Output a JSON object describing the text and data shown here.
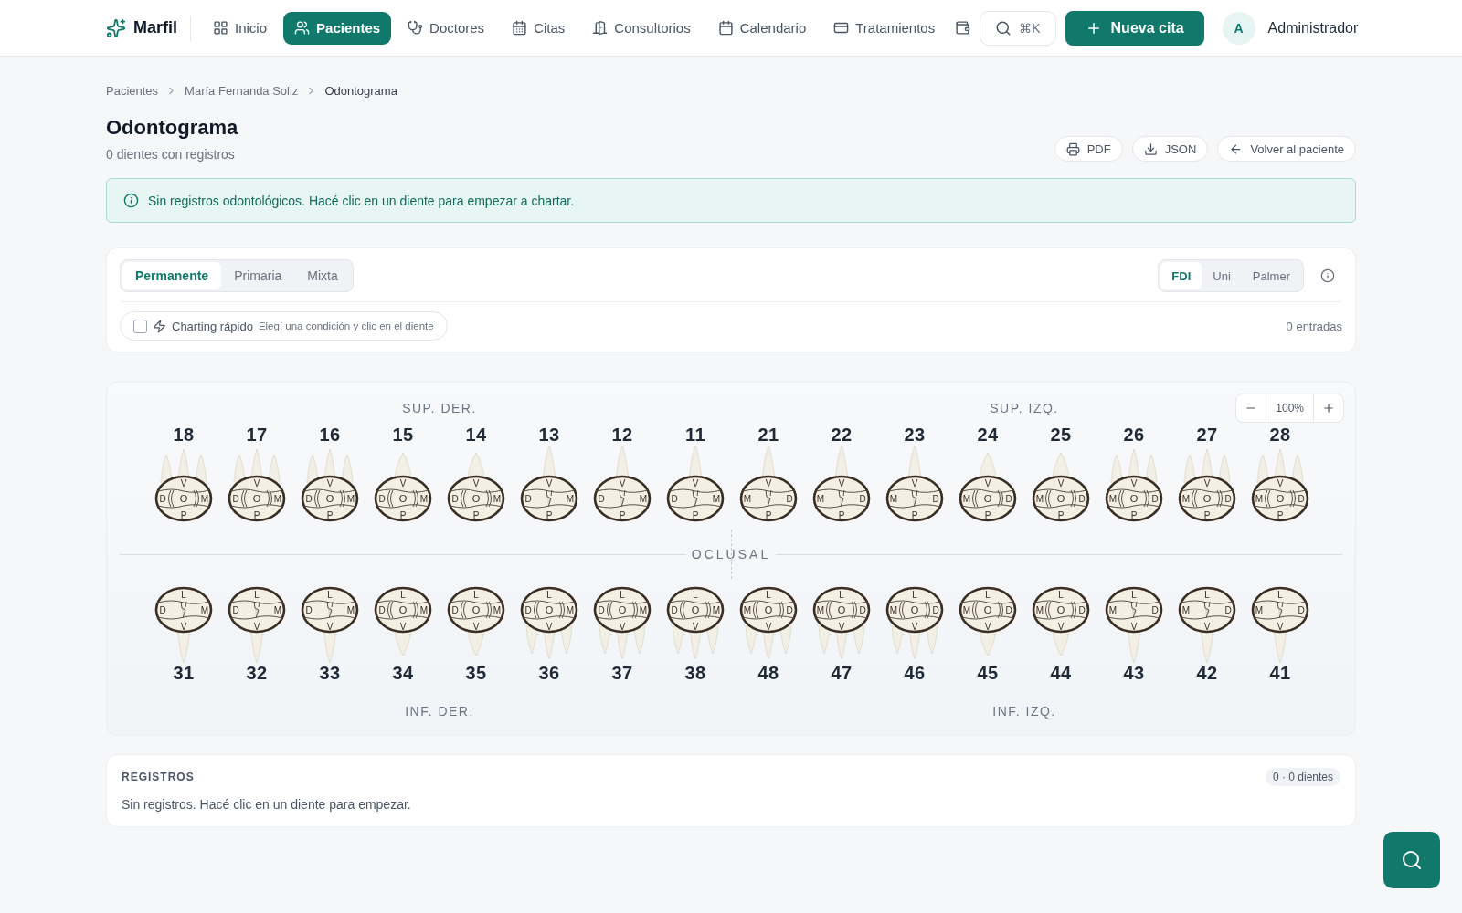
{
  "nav": {
    "brand": "Marfil",
    "items": [
      {
        "label": "Inicio",
        "selected": false
      },
      {
        "label": "Pacientes",
        "selected": true
      },
      {
        "label": "Doctores",
        "selected": false
      },
      {
        "label": "Citas",
        "selected": false
      },
      {
        "label": "Consultorios",
        "selected": false
      },
      {
        "label": "Calendario",
        "selected": false
      },
      {
        "label": "Tratamientos",
        "selected": false
      }
    ],
    "search_shortcut": "⌘K",
    "new_button": "Nueva cita",
    "user": {
      "initial": "A",
      "name": "Administrador"
    }
  },
  "breadcrumb": [
    "Pacientes",
    "María Fernanda Soliz",
    "Odontograma"
  ],
  "page": {
    "title": "Odontograma",
    "subtitle": "0 dientes con registros",
    "actions": [
      "PDF",
      "JSON",
      "Volver al paciente"
    ]
  },
  "alert": "Sin registros odontológicos. Hacé clic en un diente para empezar a chartar.",
  "controls": {
    "dentition_tabs": [
      {
        "label": "Permanente",
        "selected": true
      },
      {
        "label": "Primaria",
        "selected": false
      },
      {
        "label": "Mixta",
        "selected": false
      }
    ],
    "notation_tabs": [
      {
        "label": "FDI",
        "selected": true
      },
      {
        "label": "Uni",
        "selected": false
      },
      {
        "label": "Palmer",
        "selected": false
      }
    ],
    "quick_charting": {
      "label": "Charting rápido",
      "hint": "Elegí una condición y clic en el diente",
      "checked": false
    },
    "entries": "0 entradas"
  },
  "chart": {
    "zoom": "100%",
    "upper_labels": [
      "SUP. DER.",
      "SUP. IZQ."
    ],
    "occlusal": "OCLUSAL",
    "lower_labels": [
      "INF. DER.",
      "INF. IZQ."
    ],
    "upper_teeth": [
      {
        "number": "18",
        "kind": "molar",
        "top": "V",
        "left": "D",
        "center": "O",
        "right": "M",
        "bottom": "P"
      },
      {
        "number": "17",
        "kind": "molar",
        "top": "V",
        "left": "D",
        "center": "O",
        "right": "M",
        "bottom": "P"
      },
      {
        "number": "16",
        "kind": "molar",
        "top": "V",
        "left": "D",
        "center": "O",
        "right": "M",
        "bottom": "P"
      },
      {
        "number": "15",
        "kind": "premolar",
        "top": "V",
        "left": "D",
        "center": "O",
        "right": "M",
        "bottom": "P"
      },
      {
        "number": "14",
        "kind": "premolar",
        "top": "V",
        "left": "D",
        "center": "O",
        "right": "M",
        "bottom": "P"
      },
      {
        "number": "13",
        "kind": "anterior",
        "top": "V",
        "left": "D",
        "right": "M",
        "bottom": "P"
      },
      {
        "number": "12",
        "kind": "anterior",
        "top": "V",
        "left": "D",
        "right": "M",
        "bottom": "P"
      },
      {
        "number": "11",
        "kind": "anterior",
        "top": "V",
        "left": "D",
        "right": "M",
        "bottom": "P"
      },
      {
        "number": "21",
        "kind": "anterior",
        "top": "V",
        "left": "M",
        "right": "D",
        "bottom": "P"
      },
      {
        "number": "22",
        "kind": "anterior",
        "top": "V",
        "left": "M",
        "right": "D",
        "bottom": "P"
      },
      {
        "number": "23",
        "kind": "anterior",
        "top": "V",
        "left": "M",
        "right": "D",
        "bottom": "P"
      },
      {
        "number": "24",
        "kind": "premolar",
        "top": "V",
        "left": "M",
        "center": "O",
        "right": "D",
        "bottom": "P"
      },
      {
        "number": "25",
        "kind": "premolar",
        "top": "V",
        "left": "M",
        "center": "O",
        "right": "D",
        "bottom": "P"
      },
      {
        "number": "26",
        "kind": "molar",
        "top": "V",
        "left": "M",
        "center": "O",
        "right": "D",
        "bottom": "P"
      },
      {
        "number": "27",
        "kind": "molar",
        "top": "V",
        "left": "M",
        "center": "O",
        "right": "D",
        "bottom": "P"
      },
      {
        "number": "28",
        "kind": "molar",
        "top": "V",
        "left": "M",
        "center": "O",
        "right": "D",
        "bottom": "P"
      }
    ],
    "lower_teeth": [
      {
        "number": "31",
        "kind": "anterior",
        "top": "L",
        "left": "D",
        "right": "M",
        "bottom": "V"
      },
      {
        "number": "32",
        "kind": "anterior",
        "top": "L",
        "left": "D",
        "right": "M",
        "bottom": "V"
      },
      {
        "number": "33",
        "kind": "anterior",
        "top": "L",
        "left": "D",
        "right": "M",
        "bottom": "V"
      },
      {
        "number": "34",
        "kind": "premolar",
        "top": "L",
        "left": "D",
        "center": "O",
        "right": "M",
        "bottom": "V"
      },
      {
        "number": "35",
        "kind": "premolar",
        "top": "L",
        "left": "D",
        "center": "O",
        "right": "M",
        "bottom": "V"
      },
      {
        "number": "36",
        "kind": "molar",
        "top": "L",
        "left": "D",
        "center": "O",
        "right": "M",
        "bottom": "V"
      },
      {
        "number": "37",
        "kind": "molar",
        "top": "L",
        "left": "D",
        "center": "O",
        "right": "M",
        "bottom": "V"
      },
      {
        "number": "38",
        "kind": "molar",
        "top": "L",
        "left": "D",
        "center": "O",
        "right": "M",
        "bottom": "V"
      },
      {
        "number": "48",
        "kind": "molar",
        "top": "L",
        "left": "M",
        "center": "O",
        "right": "D",
        "bottom": "V"
      },
      {
        "number": "47",
        "kind": "molar",
        "top": "L",
        "left": "M",
        "center": "O",
        "right": "D",
        "bottom": "V"
      },
      {
        "number": "46",
        "kind": "molar",
        "top": "L",
        "left": "M",
        "center": "O",
        "right": "D",
        "bottom": "V"
      },
      {
        "number": "45",
        "kind": "premolar",
        "top": "L",
        "left": "M",
        "center": "O",
        "right": "D",
        "bottom": "V"
      },
      {
        "number": "44",
        "kind": "premolar",
        "top": "L",
        "left": "M",
        "center": "O",
        "right": "D",
        "bottom": "V"
      },
      {
        "number": "43",
        "kind": "anterior",
        "top": "L",
        "left": "M",
        "right": "D",
        "bottom": "V"
      },
      {
        "number": "42",
        "kind": "anterior",
        "top": "L",
        "left": "M",
        "right": "D",
        "bottom": "V"
      },
      {
        "number": "41",
        "kind": "anterior",
        "top": "L",
        "left": "M",
        "right": "D",
        "bottom": "V"
      }
    ]
  },
  "records": {
    "title": "REGISTROS",
    "badge": "0 · 0 dientes",
    "empty": "Sin registros. Hacé clic en un diente para empezar."
  }
}
